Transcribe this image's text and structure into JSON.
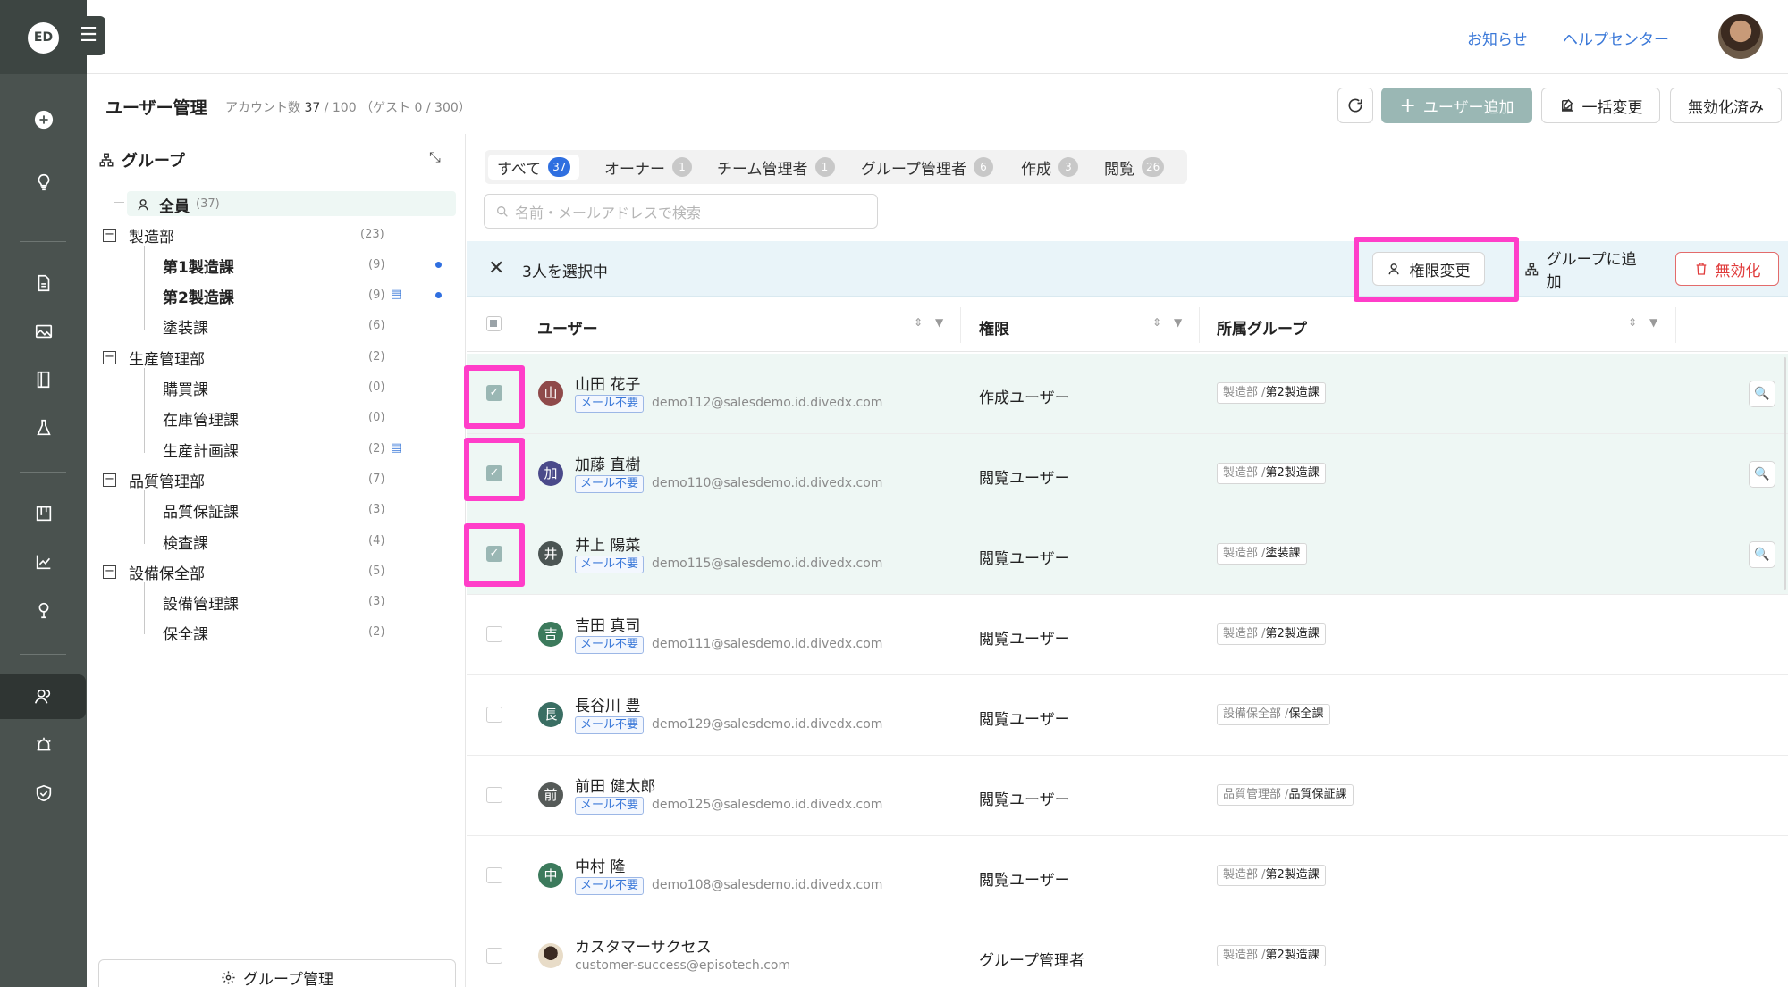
{
  "app": {
    "logo_text": "ED"
  },
  "topbar": {
    "news": "お知らせ",
    "help": "ヘルプセンター"
  },
  "page": {
    "title": "ユーザー管理",
    "account_label": "アカウント数",
    "account_used": "37",
    "account_max": "/ 100",
    "guest": "（ゲスト 0 / 300）"
  },
  "actions": {
    "refresh": "⟳",
    "add_user": "ユーザー追加",
    "bulk_change": "一括変更",
    "disabled": "無効化済み"
  },
  "groups": {
    "title": "グループ",
    "tree": [
      {
        "label": "全員",
        "count": "(37)"
      },
      {
        "label": "製造部",
        "count": "(23)"
      },
      {
        "label": "第1製造課",
        "count": "(9)"
      },
      {
        "label": "第2製造課",
        "count": "(9)"
      },
      {
        "label": "塗装課",
        "count": "(6)"
      },
      {
        "label": "生産管理部",
        "count": "(2)"
      },
      {
        "label": "購買課",
        "count": "(0)"
      },
      {
        "label": "在庫管理課",
        "count": "(0)"
      },
      {
        "label": "生産計画課",
        "count": "(2)"
      },
      {
        "label": "品質管理部",
        "count": "(7)"
      },
      {
        "label": "品質保証課",
        "count": "(3)"
      },
      {
        "label": "検査課",
        "count": "(4)"
      },
      {
        "label": "設備保全部",
        "count": "(5)"
      },
      {
        "label": "設備管理課",
        "count": "(3)"
      },
      {
        "label": "保全課",
        "count": "(2)"
      }
    ],
    "manage_button": "グループ管理"
  },
  "tabs": [
    {
      "label": "すべて",
      "count": "37"
    },
    {
      "label": "オーナー",
      "count": "1"
    },
    {
      "label": "チーム管理者",
      "count": "1"
    },
    {
      "label": "グループ管理者",
      "count": "6"
    },
    {
      "label": "作成",
      "count": "3"
    },
    {
      "label": "閲覧",
      "count": "26"
    }
  ],
  "search": {
    "placeholder": "名前・メールアドレスで検索"
  },
  "selection": {
    "text": "3人を選択中",
    "change_permission": "権限変更",
    "add_to_group": "グループに追加",
    "disable": "無効化"
  },
  "table": {
    "columns": [
      "ユーザー",
      "権限",
      "所属グループ"
    ],
    "rows": [
      {
        "initial": "山",
        "color": "#8f4a4a",
        "name": "山田 花子",
        "tag": "メール不要",
        "email": "demo112@salesdemo.id.divedx.com",
        "role": "作成ユーザー",
        "group_parent": "製造部 /",
        "group": "第2製造課",
        "selected": true
      },
      {
        "initial": "加",
        "color": "#4a4a8a",
        "name": "加藤 直樹",
        "tag": "メール不要",
        "email": "demo110@salesdemo.id.divedx.com",
        "role": "閲覧ユーザー",
        "group_parent": "製造部 /",
        "group": "第2製造課",
        "selected": true
      },
      {
        "initial": "井",
        "color": "#4b5553",
        "name": "井上 陽菜",
        "tag": "メール不要",
        "email": "demo115@salesdemo.id.divedx.com",
        "role": "閲覧ユーザー",
        "group_parent": "製造部 /",
        "group": "塗装課",
        "selected": true
      },
      {
        "initial": "吉",
        "color": "#3c7a5c",
        "name": "吉田 真司",
        "tag": "メール不要",
        "email": "demo111@salesdemo.id.divedx.com",
        "role": "閲覧ユーザー",
        "group_parent": "製造部 /",
        "group": "第2製造課",
        "selected": false
      },
      {
        "initial": "長",
        "color": "#3a6e63",
        "name": "長谷川 豊",
        "tag": "メール不要",
        "email": "demo129@salesdemo.id.divedx.com",
        "role": "閲覧ユーザー",
        "group_parent": "設備保全部 /",
        "group": "保全課",
        "selected": false
      },
      {
        "initial": "前",
        "color": "#555a58",
        "name": "前田 健太郎",
        "tag": "メール不要",
        "email": "demo125@salesdemo.id.divedx.com",
        "role": "閲覧ユーザー",
        "group_parent": "品質管理部 /",
        "group": "品質保証課",
        "selected": false
      },
      {
        "initial": "中",
        "color": "#3c7a5c",
        "name": "中村 隆",
        "tag": "メール不要",
        "email": "demo108@salesdemo.id.divedx.com",
        "role": "閲覧ユーザー",
        "group_parent": "製造部 /",
        "group": "第2製造課",
        "selected": false
      },
      {
        "initial": "",
        "color": "#d9c6a8",
        "name": "カスタマーサクセス",
        "tag": "",
        "email": "customer-success@episotech.com",
        "role": "グループ管理者",
        "group_parent": "製造部 /",
        "group": "第2製造課",
        "selected": false
      }
    ]
  }
}
